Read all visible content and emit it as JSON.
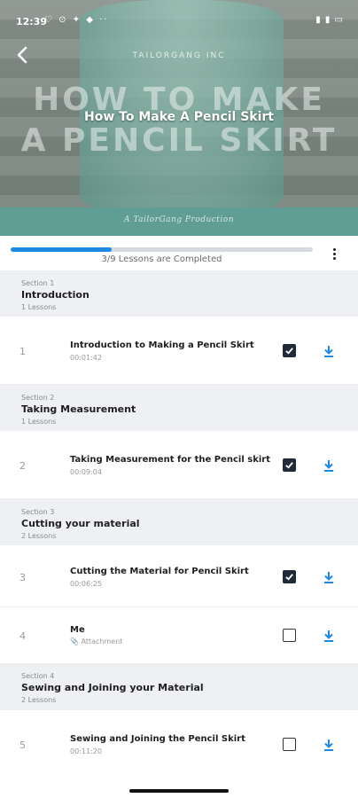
{
  "status_bar": {
    "time": "12:39",
    "notification_icons": "♡ ⊙ ✦ ◆ ··",
    "right_icons": "▮ ▮ ▭"
  },
  "hero": {
    "brand": "TAILORGANG INC",
    "big_line1": "HOW TO MAKE",
    "big_line2": "A PENCIL SKIRT",
    "title": "How To Make A Pencil Skirt",
    "production": "A TailorGang Production"
  },
  "progress": {
    "fraction": 0.333,
    "text": "3/9 Lessons are Completed"
  },
  "sections": [
    {
      "label": "Section 1",
      "title": "Introduction",
      "count": "1 Lessons",
      "lessons": [
        {
          "num": "1",
          "title": "Introduction to Making a Pencil Skirt",
          "sub": "00:01:42",
          "checked": true
        }
      ]
    },
    {
      "label": "Section 2",
      "title": "Taking Measurement",
      "count": "1 Lessons",
      "lessons": [
        {
          "num": "2",
          "title": "Taking Measurement for the Pencil skirt",
          "sub": "00:09:04",
          "checked": true
        }
      ]
    },
    {
      "label": "Section 3",
      "title": "Cutting your material",
      "count": "2 Lessons",
      "lessons": [
        {
          "num": "3",
          "title": "Cutting the Material for Pencil Skirt",
          "sub": "00:06:25",
          "checked": true
        },
        {
          "num": "4",
          "title": "Me",
          "sub": "Attachment",
          "checked": false
        }
      ]
    },
    {
      "label": "Section 4",
      "title": "Sewing and Joining your Material",
      "count": "2 Lessons",
      "lessons": [
        {
          "num": "5",
          "title": "Sewing and Joining the Pencil Skirt",
          "sub": "00:11:20",
          "checked": false
        }
      ]
    }
  ],
  "colors": {
    "accent": "#1e88e5",
    "checked": "#1f2a3a",
    "section_bg": "#eef0f3"
  }
}
